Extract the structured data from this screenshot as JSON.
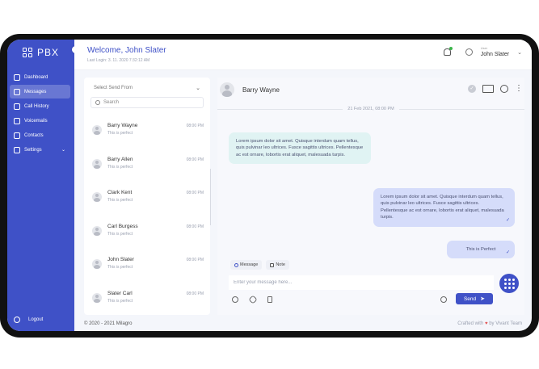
{
  "brand": {
    "name": "PBX"
  },
  "sidebar": {
    "items": [
      {
        "label": "Dashboard",
        "icon": "dashboard-icon",
        "active": false
      },
      {
        "label": "Messages",
        "icon": "message-icon",
        "active": true
      },
      {
        "label": "Call History",
        "icon": "phone-icon",
        "active": false
      },
      {
        "label": "Voicemails",
        "icon": "voicemail-icon",
        "active": false
      },
      {
        "label": "Contacts",
        "icon": "contacts-icon",
        "active": false
      },
      {
        "label": "Settings",
        "icon": "gear-icon",
        "active": false
      }
    ],
    "logout_label": "Logout"
  },
  "header": {
    "welcome": "Welcome, John Slater",
    "last_login": "Last Login: 3. 11. 2020 7:32:12 AM",
    "user_role": "User",
    "user_name": "John Slater"
  },
  "contacts": {
    "select_placeholder": "Select Send  From",
    "search_placeholder": "Search",
    "list": [
      {
        "name": "Barry Wayne",
        "preview": "This is perfect",
        "time": "08:00 PM"
      },
      {
        "name": "Barry Allen",
        "preview": "This is perfect",
        "time": "08:00 PM"
      },
      {
        "name": "Clark Kent",
        "preview": "This is perfect",
        "time": "08:00 PM"
      },
      {
        "name": "Carl Burgess",
        "preview": "This is perfect",
        "time": "08:00 PM"
      },
      {
        "name": "John Slater",
        "preview": "This is perfect",
        "time": "08:00 PM"
      },
      {
        "name": "Slater Carl",
        "preview": "This is perfect",
        "time": "08:00 PM"
      }
    ]
  },
  "chat": {
    "contact_name": "Barry Wayne",
    "date": "21 Feb 2021, 08:00 PM",
    "messages": {
      "incoming": "Lorem ipsum dolor sit amet. Quisque interdum quam tellus, quis pulvinar leo ultrices. Fusce sagittis ultrices. Pellentesque ac est ornare, lobortis erat aliquet, malesuada turpis.",
      "outgoing": "Lorem ipsum dolor sit amet. Quisque interdum quam tellus, quis pulvinar leo ultrices. Fusce sagittis ultrices. Pellentesque ac est ornare, lobortis erat aliquet, malesuada turpis.",
      "outgoing_short": "This is Perfect"
    },
    "tick": "✓",
    "compose": {
      "tab_message": "Message",
      "tab_note": "Note",
      "placeholder": "Enter your message here...",
      "send_label": "Send"
    }
  },
  "footer": {
    "copyright": "© 2020 - 2021  Milagro",
    "crafted_prefix": "Crafted with",
    "crafted_suffix": "by Vivant Team"
  }
}
